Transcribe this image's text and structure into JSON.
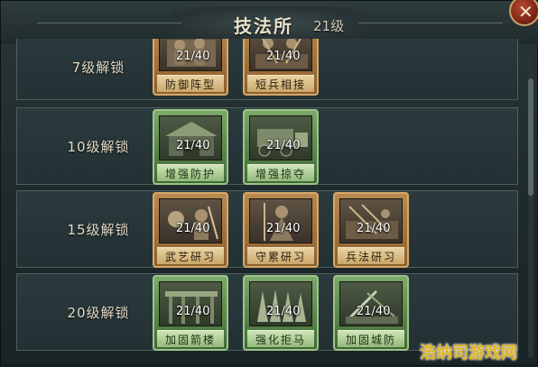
{
  "header": {
    "title": "技法所",
    "level": "21级"
  },
  "rows": [
    {
      "label": "7级解锁",
      "cards": [
        {
          "name": "防御阵型",
          "count": "21/40",
          "style": "bronze",
          "icon": "fortress-soldiers-icon"
        },
        {
          "name": "短兵相接",
          "count": "21/40",
          "style": "bronze",
          "icon": "melee-soldiers-icon"
        }
      ]
    },
    {
      "label": "10级解锁",
      "cards": [
        {
          "name": "增强防护",
          "count": "21/40",
          "style": "green",
          "icon": "barracks-defense-icon"
        },
        {
          "name": "增强掠夺",
          "count": "21/40",
          "style": "green",
          "icon": "plunder-wagon-icon"
        }
      ]
    },
    {
      "label": "15级解锁",
      "cards": [
        {
          "name": "武艺研习",
          "count": "21/40",
          "style": "bronze",
          "icon": "martial-training-icon"
        },
        {
          "name": "守累研习",
          "count": "21/40",
          "style": "bronze",
          "icon": "guard-general-icon"
        },
        {
          "name": "兵法研习",
          "count": "21/40",
          "style": "bronze",
          "icon": "strategy-study-icon"
        }
      ]
    },
    {
      "label": "20级解锁",
      "cards": [
        {
          "name": "加固箭楼",
          "count": "21/40",
          "style": "green",
          "icon": "arrow-tower-icon"
        },
        {
          "name": "强化拒马",
          "count": "21/40",
          "style": "green",
          "icon": "spike-barrier-icon"
        },
        {
          "name": "加固城防",
          "count": "21/40",
          "style": "green",
          "icon": "city-wall-icon"
        }
      ]
    }
  ],
  "close_icon": "close-icon",
  "watermark": "浩纳司游戏网"
}
